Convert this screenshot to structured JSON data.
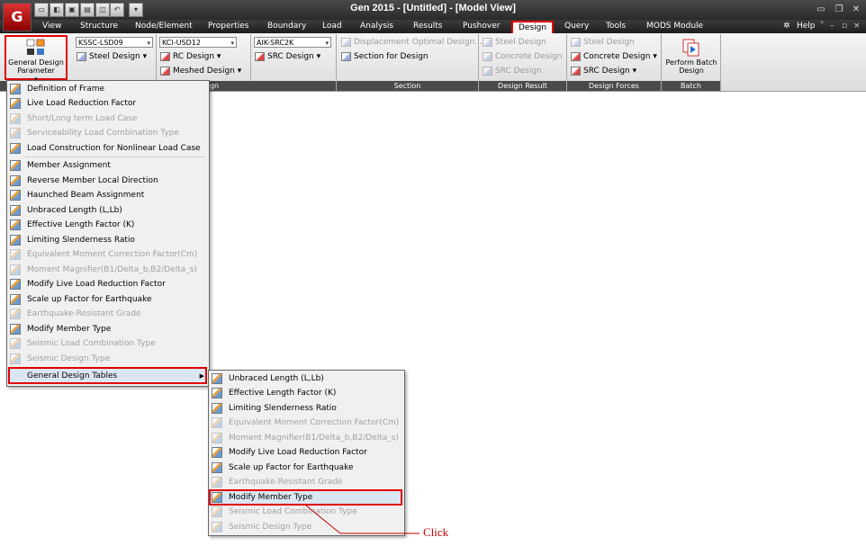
{
  "window": {
    "title": "Gen 2015 - [Untitled] - [Model View]",
    "app_logo": "G",
    "help_label": "Help"
  },
  "menu": {
    "items": [
      "View",
      "Structure",
      "Node/Element",
      "Properties",
      "Boundary",
      "Load",
      "Analysis",
      "Results",
      "Pushover",
      "Design",
      "Query",
      "Tools",
      "MODS Module"
    ]
  },
  "ribbon": {
    "gdp_label": "General Design Parameter",
    "combos": [
      "KSSC-LSD09",
      "KCI-USD12",
      "AIK-SRC2K"
    ],
    "buttons": {
      "steel_design": "Steel Design",
      "rc_design": "RC Design",
      "meshed_design": "Meshed Design",
      "src_design": "SRC Design",
      "displacement_optimal": "Displacement Optimal Design...",
      "section_for_design": "Section for Design",
      "dr_steel": "Steel Design",
      "dr_concrete": "Concrete Design",
      "dr_src": "SRC Design",
      "df_steel": "Steel Design",
      "df_concrete": "Concrete Design",
      "df_src": "SRC Design",
      "perform_batch": "Perform Batch Design"
    },
    "group_labels": {
      "design_partial": "gn",
      "section": "Section",
      "design_result": "Design Result",
      "design_forces": "Design Forces",
      "batch": "Batch"
    }
  },
  "design_menu": [
    {
      "label": "Definition of Frame",
      "enabled": true
    },
    {
      "label": "Live Load Reduction Factor",
      "enabled": true
    },
    {
      "label": "Short/Long term Load Case",
      "enabled": false
    },
    {
      "label": "Serviceability Load Combination Type",
      "enabled": false
    },
    {
      "label": "Load Construction for Nonlinear Load Case",
      "enabled": true
    },
    {
      "label": "Member Assignment",
      "enabled": true
    },
    {
      "label": "Reverse Member Local Direction",
      "enabled": true
    },
    {
      "label": "Haunched Beam Assignment",
      "enabled": true
    },
    {
      "label": "Unbraced Length (L,Lb)",
      "enabled": true
    },
    {
      "label": "Effective Length Factor (K)",
      "enabled": true
    },
    {
      "label": "Limiting Slenderness Ratio",
      "enabled": true
    },
    {
      "label": "Equivalent Moment Correction Factor(Cm)",
      "enabled": false
    },
    {
      "label": "Moment Magnifier(B1/Delta_b,B2/Delta_s)",
      "enabled": false
    },
    {
      "label": "Modify Live Load Reduction Factor",
      "enabled": true
    },
    {
      "label": "Scale up Factor for Earthquake",
      "enabled": true
    },
    {
      "label": "Earthquake-Resistant Grade",
      "enabled": false
    },
    {
      "label": "Modify Member Type",
      "enabled": true
    },
    {
      "label": "Seismic Load Combination Type",
      "enabled": false
    },
    {
      "label": "Seismic Design Type",
      "enabled": false
    },
    {
      "label": "General Design Tables",
      "enabled": true
    }
  ],
  "tables_submenu": [
    {
      "label": "Unbraced Length (L,Lb)",
      "enabled": true
    },
    {
      "label": "Effective Length Factor (K)",
      "enabled": true
    },
    {
      "label": "Limiting Slenderness Ratio",
      "enabled": true
    },
    {
      "label": "Equivalent Moment Correction Factor(Cm)",
      "enabled": false
    },
    {
      "label": "Moment Magnifier(B1/Delta_b,B2/Delta_s)",
      "enabled": false
    },
    {
      "label": "Modify Live Load Reduction Factor",
      "enabled": true
    },
    {
      "label": "Scale up Factor for Earthquake",
      "enabled": true
    },
    {
      "label": "Earthquake-Resistant Grade",
      "enabled": false
    },
    {
      "label": "Modify Member Type",
      "enabled": true
    },
    {
      "label": "Seismic Load Combination Type",
      "enabled": false
    },
    {
      "label": "Seismic Design Type",
      "enabled": false
    }
  ],
  "annotation": {
    "click_label": "Click",
    "color": "#c00000"
  }
}
